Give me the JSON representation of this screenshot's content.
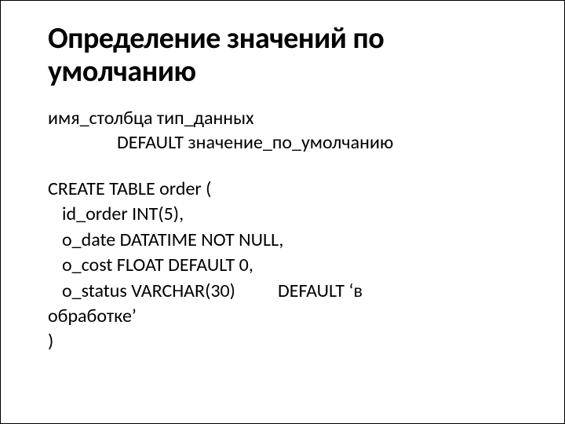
{
  "title": "Определение значений по умолчанию",
  "syntax": {
    "line1": "имя_столбца тип_данных",
    "line2": "DEFAULT  значение_по_умолчанию"
  },
  "code": {
    "l1": "CREATE TABLE order (",
    "l2": "id_order INT(5),",
    "l3": "o_date DATATIME NOT NULL,",
    "l4": "o_cost FLOAT DEFAULT 0,",
    "l5a": "o_status VARCHAR(30)",
    "l5b": "DEFAULT ‘в",
    "l6": "обработке’",
    "l7": ")"
  }
}
